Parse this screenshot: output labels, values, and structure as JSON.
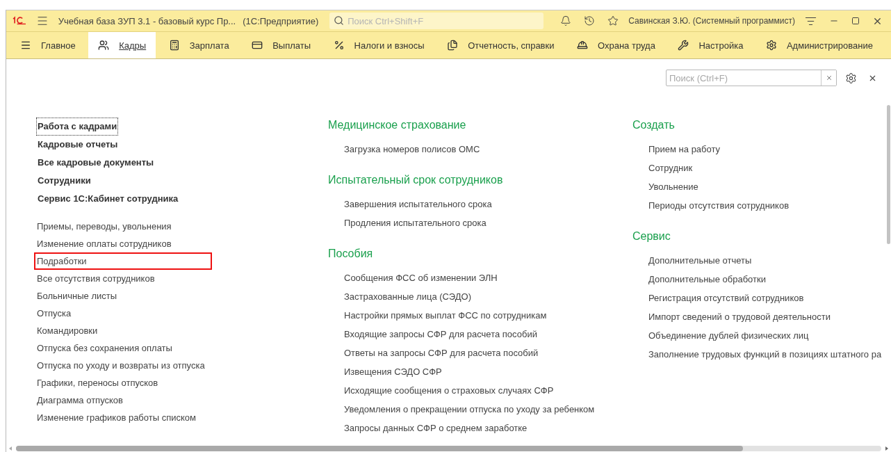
{
  "title_bar": {
    "title": "Учебная база ЗУП 3.1 - базовый курс Пр...",
    "app_name": "(1С:Предприятие)",
    "search_placeholder": "Поиск Ctrl+Shift+F",
    "user": "Савинская З.Ю. (Системный программист)"
  },
  "sections": [
    {
      "label": "Главное",
      "selected": false
    },
    {
      "label": "Кадры",
      "selected": true
    },
    {
      "label": "Зарплата",
      "selected": false
    },
    {
      "label": "Выплаты",
      "selected": false
    },
    {
      "label": "Налоги и взносы",
      "selected": false
    },
    {
      "label": "Отчетность, справки",
      "selected": false
    },
    {
      "label": "Охрана труда",
      "selected": false
    },
    {
      "label": "Настройка",
      "selected": false
    },
    {
      "label": "Администрирование",
      "selected": false
    }
  ],
  "content_search": {
    "placeholder": "Поиск (Ctrl+F)"
  },
  "left_column": {
    "main_links": [
      {
        "label": "Работа с кадрами",
        "focused": true
      },
      {
        "label": "Кадровые отчеты",
        "focused": false
      },
      {
        "label": "Все кадровые документы",
        "focused": false
      },
      {
        "label": "Сотрудники",
        "focused": false
      },
      {
        "label": "Сервис 1С:Кабинет сотрудника",
        "focused": false
      }
    ],
    "links": [
      {
        "label": "Приемы, переводы, увольнения",
        "highlighted": false
      },
      {
        "label": "Изменение оплаты сотрудников",
        "highlighted": false
      },
      {
        "label": "Подработки",
        "highlighted": true
      },
      {
        "label": "Все отсутствия сотрудников",
        "highlighted": false
      },
      {
        "label": "Больничные листы",
        "highlighted": false
      },
      {
        "label": "Отпуска",
        "highlighted": false
      },
      {
        "label": "Командировки",
        "highlighted": false
      },
      {
        "label": "Отпуска без сохранения оплаты",
        "highlighted": false
      },
      {
        "label": "Отпуска по уходу и возвраты из отпуска",
        "highlighted": false
      },
      {
        "label": "Графики, переносы отпусков",
        "highlighted": false
      },
      {
        "label": "Диаграмма отпусков",
        "highlighted": false
      },
      {
        "label": "Изменение графиков работы списком",
        "highlighted": false
      }
    ]
  },
  "middle_column": [
    {
      "heading": "Медицинское страхование",
      "links": [
        "Загрузка номеров полисов ОМС"
      ]
    },
    {
      "heading": "Испытательный срок сотрудников",
      "links": [
        "Завершения испытательного срока",
        "Продления испытательного срока"
      ]
    },
    {
      "heading": "Пособия",
      "links": [
        "Сообщения ФСС об изменении ЭЛН",
        "Застрахованные лица (СЭДО)",
        "Настройки прямых выплат ФСС по сотрудникам",
        "Входящие запросы СФР для расчета пособий",
        "Ответы на запросы СФР для расчета пособий",
        "Извещения СЭДО СФР",
        "Исходящие сообщения о страховых случаях СФР",
        "Уведомления о прекращении отпуска по уходу за ребенком",
        "Запросы данных СФР о среднем заработке"
      ]
    }
  ],
  "right_column": [
    {
      "heading": "Создать",
      "links": [
        "Прием на работу",
        "Сотрудник",
        "Увольнение",
        "Периоды отсутствия сотрудников"
      ]
    },
    {
      "heading": "Сервис",
      "links": [
        "Дополнительные отчеты",
        "Дополнительные обработки",
        "Регистрация отсутствий сотрудников",
        "Импорт сведений о трудовой деятельности",
        "Объединение дублей физических лиц",
        "Заполнение трудовых функций в позициях штатного ра"
      ]
    }
  ]
}
